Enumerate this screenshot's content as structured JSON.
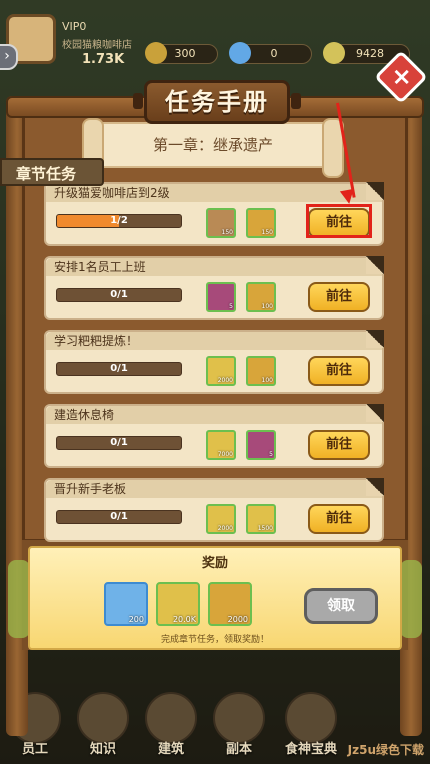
{
  "player": {
    "vip": "VIP0",
    "shop": "校园猫粮咖啡店",
    "money": "1.73K"
  },
  "resources": [
    {
      "name": "coin",
      "value": "300"
    },
    {
      "name": "diamond",
      "value": "0"
    },
    {
      "name": "heart",
      "value": "9428"
    }
  ],
  "dialog": {
    "title": "任务手册",
    "chapter": "第一章：继承遗产",
    "tab": "章节任务"
  },
  "tasks": [
    {
      "name": "升级猫爱咖啡店到2级",
      "progress": "1/2",
      "fill": 0.5,
      "rewards": [
        {
          "icon": "poop-icon",
          "count": "150"
        },
        {
          "icon": "trophy-icon",
          "count": "150"
        }
      ],
      "button": "前往"
    },
    {
      "name": "安排1名员工上班",
      "progress": "0/1",
      "fill": 0,
      "rewards": [
        {
          "icon": "chest-icon",
          "count": "5"
        },
        {
          "icon": "trophy-icon",
          "count": "100"
        }
      ],
      "button": "前往"
    },
    {
      "name": "学习粑粑提炼！",
      "progress": "0/1",
      "fill": 0,
      "rewards": [
        {
          "icon": "coin-icon",
          "count": "2000"
        },
        {
          "icon": "trophy-icon",
          "count": "100"
        }
      ],
      "button": "前往"
    },
    {
      "name": "建造休息椅",
      "progress": "0/1",
      "fill": 0,
      "rewards": [
        {
          "icon": "coin-icon",
          "count": "7000"
        },
        {
          "icon": "chest-icon",
          "count": "5"
        }
      ],
      "button": "前往"
    },
    {
      "name": "晋升新手老板",
      "progress": "0/1",
      "fill": 0,
      "rewards": [
        {
          "icon": "coin-icon",
          "count": "2000"
        },
        {
          "icon": "coin-icon",
          "count": "1500"
        }
      ],
      "button": "前往"
    }
  ],
  "banner": {
    "title": "奖励",
    "rewards": [
      {
        "icon": "diamond-icon",
        "count": "200"
      },
      {
        "icon": "coin-icon",
        "count": "20.0K"
      },
      {
        "icon": "trophy-icon",
        "count": "2000"
      }
    ],
    "claim": "领取",
    "hint": "完成章节任务，领取奖励！"
  },
  "nav": [
    "员工",
    "知识",
    "建筑",
    "副本",
    "食神宝典"
  ],
  "watermark": "Jz5u绿色下载",
  "colors": {
    "highlight": "#e2231a",
    "button": "#f0b125",
    "progress": "#f08a2e"
  }
}
